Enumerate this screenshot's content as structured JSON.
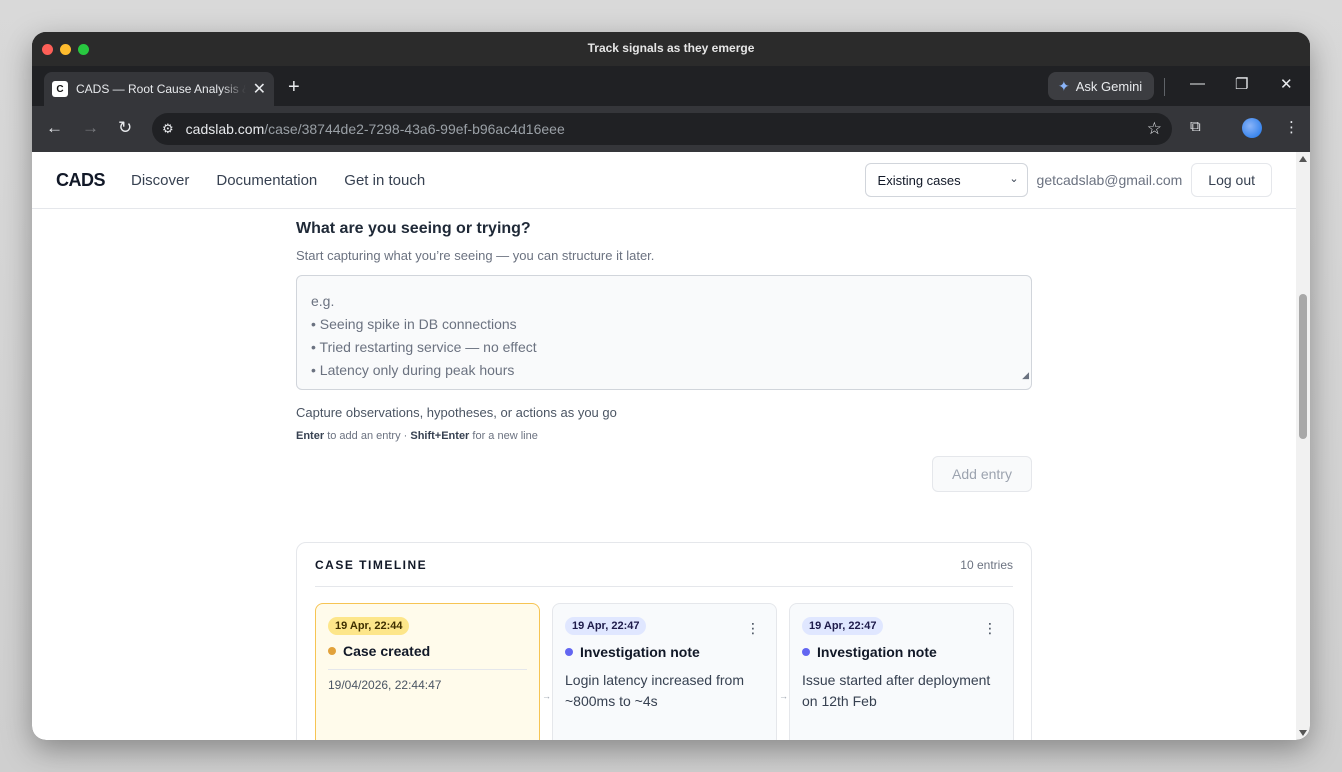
{
  "window": {
    "title": "Track signals as they emerge"
  },
  "browser": {
    "tab_title": "CADS — Root Cause Analysis & Decision Support",
    "favicon_letter": "C",
    "ask_gemini": "Ask Gemini",
    "url_host": "cadslab.com",
    "url_path": "/case/38744de2-7298-43a6-99ef-b96ac4d16eee"
  },
  "app": {
    "logo": "CADS",
    "nav": [
      "Discover",
      "Documentation",
      "Get in touch"
    ],
    "case_select": "Existing cases",
    "user_email": "getcadslab@gmail.com",
    "logout": "Log out"
  },
  "entry": {
    "heading": "What are you seeing or trying?",
    "subheading": "Start capturing what you’re seeing — you can structure it later.",
    "placeholder_lines": [
      "e.g.",
      "• Seeing spike in DB connections",
      "• Tried restarting service — no effect",
      "• Latency only during peak hours"
    ],
    "hint": "Capture observations, hypotheses, or actions as you go",
    "shortcut_enter": "Enter",
    "shortcut_enter_text": "to add an entry ·",
    "shortcut_shift": "Shift+Enter",
    "shortcut_shift_text": "for a new line",
    "add_button": "Add entry"
  },
  "timeline": {
    "title": "CASE TIMELINE",
    "count": "10 entries",
    "cards": [
      {
        "time": "19 Apr, 22:44",
        "title": "Case created",
        "meta": "19/04/2026, 22:44:47"
      },
      {
        "time": "19 Apr, 22:47",
        "title": "Investigation note",
        "body": "Login latency increased from ~800ms to ~4s"
      },
      {
        "time": "19 Apr, 22:47",
        "title": "Investigation note",
        "body": "Issue started after deployment on 12th Feb"
      }
    ]
  },
  "colors": {
    "created_accent": "#e2a23b",
    "note_accent": "#6366f1"
  }
}
